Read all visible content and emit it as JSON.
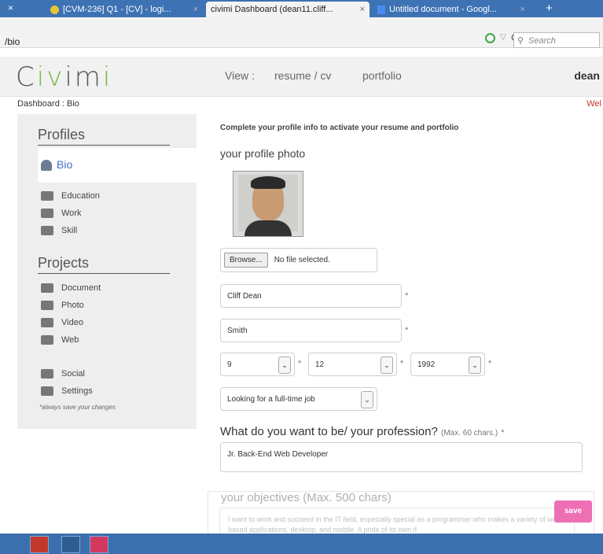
{
  "browser": {
    "tabs": [
      {
        "label": "[CVM-236] Q1 - [CV] - logi...",
        "close": "×"
      },
      {
        "label": "civimi Dashboard (dean11.cliff...",
        "close": "×"
      },
      {
        "label": "Untitled document - Googl...",
        "close": "×"
      }
    ],
    "first_close": "×",
    "new_tab": "+",
    "url": "/bio",
    "search_placeholder": "Search"
  },
  "header": {
    "logo_pre": "C",
    "logo_mid": "iv",
    "logo_post": "im",
    "logo_end": "i",
    "view_label": "View :",
    "nav": [
      "resume / cv",
      "portfolio"
    ],
    "user": "dean"
  },
  "breadcrumb": "Dashboard : Bio",
  "welcome": "Wel",
  "sidebar": {
    "profiles_title": "Profiles",
    "bio": "Bio",
    "profile_items": [
      "Education",
      "Work",
      "Skill"
    ],
    "projects_title": "Projects",
    "project_items": [
      "Document",
      "Photo",
      "Video",
      "Web"
    ],
    "social": "Social",
    "settings": "Settings",
    "note": "*always save your changes"
  },
  "form": {
    "intro": "Complete your profile info to activate your resume and portfolio",
    "photo_label": "your profile photo",
    "browse": "Browse...",
    "file_status": "No file selected.",
    "first_name": "Cliff Dean",
    "last_name": "Smith",
    "day": "9",
    "month": "12",
    "year": "1992",
    "status": "Looking for a full-time job",
    "required": "*",
    "profession_label": "What do you want to be/ your profession?",
    "profession_hint": "(Max. 60 chars.)",
    "profession_value": "Jr. Back-End Web Developer",
    "objectives_label": "your objectives (Max. 500 chars)",
    "objectives_value": "I want to work and succeed in the IT field, especially special as a programmer who makes a variety of web-based applications, desktop, and mobile. A pride of its own if",
    "save": "save"
  }
}
